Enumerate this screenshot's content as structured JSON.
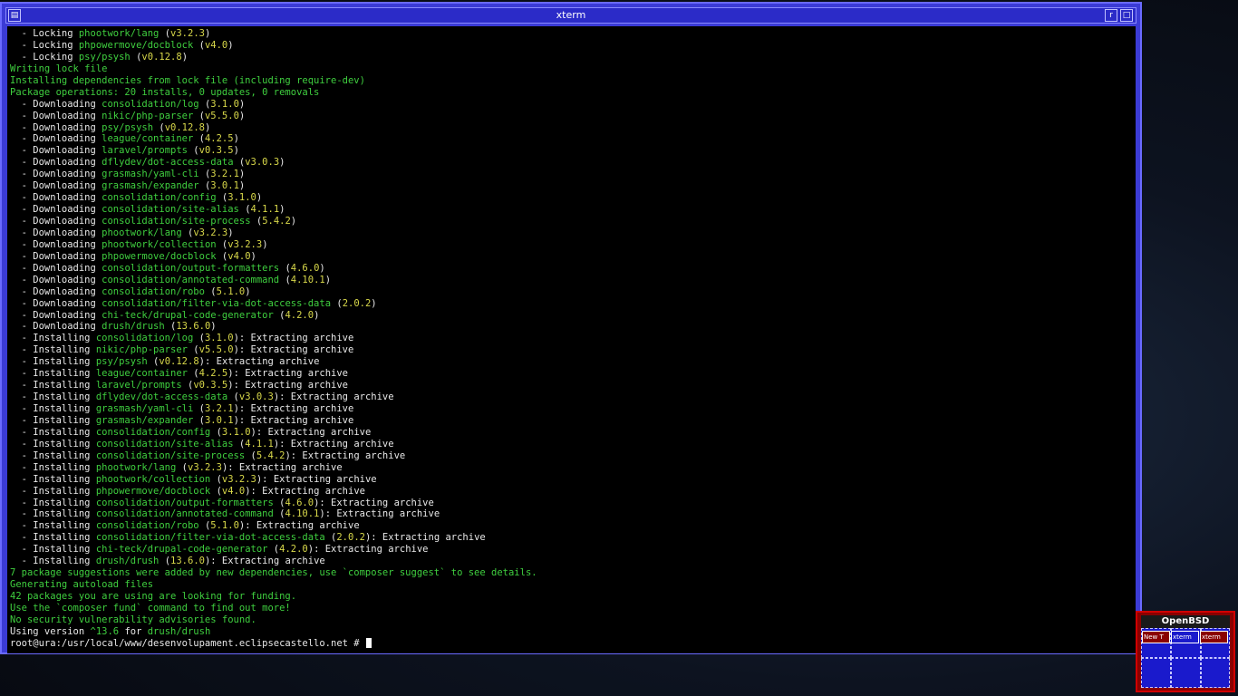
{
  "window": {
    "title": "xterm",
    "menu_icon": "window-menu-icon",
    "restore_label": "r",
    "maximize_label": "□"
  },
  "colors": {
    "terminal_bg": "#000000",
    "text": "#e8e8e8",
    "package": "#3fcf3f",
    "version": "#d8d84a",
    "frame": "#3b3bd6"
  },
  "terminal": {
    "lines": [
      [
        {
          "t": "  - Locking ",
          "c": "w"
        },
        {
          "t": "phootwork/lang",
          "c": "g"
        },
        {
          "t": " (",
          "c": "w"
        },
        {
          "t": "v3.2.3",
          "c": "y"
        },
        {
          "t": ")",
          "c": "w"
        }
      ],
      [
        {
          "t": "  - Locking ",
          "c": "w"
        },
        {
          "t": "phpowermove/docblock",
          "c": "g"
        },
        {
          "t": " (",
          "c": "w"
        },
        {
          "t": "v4.0",
          "c": "y"
        },
        {
          "t": ")",
          "c": "w"
        }
      ],
      [
        {
          "t": "  - Locking ",
          "c": "w"
        },
        {
          "t": "psy/psysh",
          "c": "g"
        },
        {
          "t": " (",
          "c": "w"
        },
        {
          "t": "v0.12.8",
          "c": "y"
        },
        {
          "t": ")",
          "c": "w"
        }
      ],
      [
        {
          "t": "Writing lock file",
          "c": "g"
        }
      ],
      [
        {
          "t": "Installing dependencies from lock file (including require-dev)",
          "c": "g"
        }
      ],
      [
        {
          "t": "Package operations: 20 installs, 0 updates, 0 removals",
          "c": "g"
        }
      ],
      [
        {
          "t": "  - Downloading ",
          "c": "w"
        },
        {
          "t": "consolidation/log",
          "c": "g"
        },
        {
          "t": " (",
          "c": "w"
        },
        {
          "t": "3.1.0",
          "c": "y"
        },
        {
          "t": ")",
          "c": "w"
        }
      ],
      [
        {
          "t": "  - Downloading ",
          "c": "w"
        },
        {
          "t": "nikic/php-parser",
          "c": "g"
        },
        {
          "t": " (",
          "c": "w"
        },
        {
          "t": "v5.5.0",
          "c": "y"
        },
        {
          "t": ")",
          "c": "w"
        }
      ],
      [
        {
          "t": "  - Downloading ",
          "c": "w"
        },
        {
          "t": "psy/psysh",
          "c": "g"
        },
        {
          "t": " (",
          "c": "w"
        },
        {
          "t": "v0.12.8",
          "c": "y"
        },
        {
          "t": ")",
          "c": "w"
        }
      ],
      [
        {
          "t": "  - Downloading ",
          "c": "w"
        },
        {
          "t": "league/container",
          "c": "g"
        },
        {
          "t": " (",
          "c": "w"
        },
        {
          "t": "4.2.5",
          "c": "y"
        },
        {
          "t": ")",
          "c": "w"
        }
      ],
      [
        {
          "t": "  - Downloading ",
          "c": "w"
        },
        {
          "t": "laravel/prompts",
          "c": "g"
        },
        {
          "t": " (",
          "c": "w"
        },
        {
          "t": "v0.3.5",
          "c": "y"
        },
        {
          "t": ")",
          "c": "w"
        }
      ],
      [
        {
          "t": "  - Downloading ",
          "c": "w"
        },
        {
          "t": "dflydev/dot-access-data",
          "c": "g"
        },
        {
          "t": " (",
          "c": "w"
        },
        {
          "t": "v3.0.3",
          "c": "y"
        },
        {
          "t": ")",
          "c": "w"
        }
      ],
      [
        {
          "t": "  - Downloading ",
          "c": "w"
        },
        {
          "t": "grasmash/yaml-cli",
          "c": "g"
        },
        {
          "t": " (",
          "c": "w"
        },
        {
          "t": "3.2.1",
          "c": "y"
        },
        {
          "t": ")",
          "c": "w"
        }
      ],
      [
        {
          "t": "  - Downloading ",
          "c": "w"
        },
        {
          "t": "grasmash/expander",
          "c": "g"
        },
        {
          "t": " (",
          "c": "w"
        },
        {
          "t": "3.0.1",
          "c": "y"
        },
        {
          "t": ")",
          "c": "w"
        }
      ],
      [
        {
          "t": "  - Downloading ",
          "c": "w"
        },
        {
          "t": "consolidation/config",
          "c": "g"
        },
        {
          "t": " (",
          "c": "w"
        },
        {
          "t": "3.1.0",
          "c": "y"
        },
        {
          "t": ")",
          "c": "w"
        }
      ],
      [
        {
          "t": "  - Downloading ",
          "c": "w"
        },
        {
          "t": "consolidation/site-alias",
          "c": "g"
        },
        {
          "t": " (",
          "c": "w"
        },
        {
          "t": "4.1.1",
          "c": "y"
        },
        {
          "t": ")",
          "c": "w"
        }
      ],
      [
        {
          "t": "  - Downloading ",
          "c": "w"
        },
        {
          "t": "consolidation/site-process",
          "c": "g"
        },
        {
          "t": " (",
          "c": "w"
        },
        {
          "t": "5.4.2",
          "c": "y"
        },
        {
          "t": ")",
          "c": "w"
        }
      ],
      [
        {
          "t": "  - Downloading ",
          "c": "w"
        },
        {
          "t": "phootwork/lang",
          "c": "g"
        },
        {
          "t": " (",
          "c": "w"
        },
        {
          "t": "v3.2.3",
          "c": "y"
        },
        {
          "t": ")",
          "c": "w"
        }
      ],
      [
        {
          "t": "  - Downloading ",
          "c": "w"
        },
        {
          "t": "phootwork/collection",
          "c": "g"
        },
        {
          "t": " (",
          "c": "w"
        },
        {
          "t": "v3.2.3",
          "c": "y"
        },
        {
          "t": ")",
          "c": "w"
        }
      ],
      [
        {
          "t": "  - Downloading ",
          "c": "w"
        },
        {
          "t": "phpowermove/docblock",
          "c": "g"
        },
        {
          "t": " (",
          "c": "w"
        },
        {
          "t": "v4.0",
          "c": "y"
        },
        {
          "t": ")",
          "c": "w"
        }
      ],
      [
        {
          "t": "  - Downloading ",
          "c": "w"
        },
        {
          "t": "consolidation/output-formatters",
          "c": "g"
        },
        {
          "t": " (",
          "c": "w"
        },
        {
          "t": "4.6.0",
          "c": "y"
        },
        {
          "t": ")",
          "c": "w"
        }
      ],
      [
        {
          "t": "  - Downloading ",
          "c": "w"
        },
        {
          "t": "consolidation/annotated-command",
          "c": "g"
        },
        {
          "t": " (",
          "c": "w"
        },
        {
          "t": "4.10.1",
          "c": "y"
        },
        {
          "t": ")",
          "c": "w"
        }
      ],
      [
        {
          "t": "  - Downloading ",
          "c": "w"
        },
        {
          "t": "consolidation/robo",
          "c": "g"
        },
        {
          "t": " (",
          "c": "w"
        },
        {
          "t": "5.1.0",
          "c": "y"
        },
        {
          "t": ")",
          "c": "w"
        }
      ],
      [
        {
          "t": "  - Downloading ",
          "c": "w"
        },
        {
          "t": "consolidation/filter-via-dot-access-data",
          "c": "g"
        },
        {
          "t": " (",
          "c": "w"
        },
        {
          "t": "2.0.2",
          "c": "y"
        },
        {
          "t": ")",
          "c": "w"
        }
      ],
      [
        {
          "t": "  - Downloading ",
          "c": "w"
        },
        {
          "t": "chi-teck/drupal-code-generator",
          "c": "g"
        },
        {
          "t": " (",
          "c": "w"
        },
        {
          "t": "4.2.0",
          "c": "y"
        },
        {
          "t": ")",
          "c": "w"
        }
      ],
      [
        {
          "t": "  - Downloading ",
          "c": "w"
        },
        {
          "t": "drush/drush",
          "c": "g"
        },
        {
          "t": " (",
          "c": "w"
        },
        {
          "t": "13.6.0",
          "c": "y"
        },
        {
          "t": ")",
          "c": "w"
        }
      ],
      [
        {
          "t": "  - Installing ",
          "c": "w"
        },
        {
          "t": "consolidation/log",
          "c": "g"
        },
        {
          "t": " (",
          "c": "w"
        },
        {
          "t": "3.1.0",
          "c": "y"
        },
        {
          "t": "): Extracting archive",
          "c": "w"
        }
      ],
      [
        {
          "t": "  - Installing ",
          "c": "w"
        },
        {
          "t": "nikic/php-parser",
          "c": "g"
        },
        {
          "t": " (",
          "c": "w"
        },
        {
          "t": "v5.5.0",
          "c": "y"
        },
        {
          "t": "): Extracting archive",
          "c": "w"
        }
      ],
      [
        {
          "t": "  - Installing ",
          "c": "w"
        },
        {
          "t": "psy/psysh",
          "c": "g"
        },
        {
          "t": " (",
          "c": "w"
        },
        {
          "t": "v0.12.8",
          "c": "y"
        },
        {
          "t": "): Extracting archive",
          "c": "w"
        }
      ],
      [
        {
          "t": "  - Installing ",
          "c": "w"
        },
        {
          "t": "league/container",
          "c": "g"
        },
        {
          "t": " (",
          "c": "w"
        },
        {
          "t": "4.2.5",
          "c": "y"
        },
        {
          "t": "): Extracting archive",
          "c": "w"
        }
      ],
      [
        {
          "t": "  - Installing ",
          "c": "w"
        },
        {
          "t": "laravel/prompts",
          "c": "g"
        },
        {
          "t": " (",
          "c": "w"
        },
        {
          "t": "v0.3.5",
          "c": "y"
        },
        {
          "t": "): Extracting archive",
          "c": "w"
        }
      ],
      [
        {
          "t": "  - Installing ",
          "c": "w"
        },
        {
          "t": "dflydev/dot-access-data",
          "c": "g"
        },
        {
          "t": " (",
          "c": "w"
        },
        {
          "t": "v3.0.3",
          "c": "y"
        },
        {
          "t": "): Extracting archive",
          "c": "w"
        }
      ],
      [
        {
          "t": "  - Installing ",
          "c": "w"
        },
        {
          "t": "grasmash/yaml-cli",
          "c": "g"
        },
        {
          "t": " (",
          "c": "w"
        },
        {
          "t": "3.2.1",
          "c": "y"
        },
        {
          "t": "): Extracting archive",
          "c": "w"
        }
      ],
      [
        {
          "t": "  - Installing ",
          "c": "w"
        },
        {
          "t": "grasmash/expander",
          "c": "g"
        },
        {
          "t": " (",
          "c": "w"
        },
        {
          "t": "3.0.1",
          "c": "y"
        },
        {
          "t": "): Extracting archive",
          "c": "w"
        }
      ],
      [
        {
          "t": "  - Installing ",
          "c": "w"
        },
        {
          "t": "consolidation/config",
          "c": "g"
        },
        {
          "t": " (",
          "c": "w"
        },
        {
          "t": "3.1.0",
          "c": "y"
        },
        {
          "t": "): Extracting archive",
          "c": "w"
        }
      ],
      [
        {
          "t": "  - Installing ",
          "c": "w"
        },
        {
          "t": "consolidation/site-alias",
          "c": "g"
        },
        {
          "t": " (",
          "c": "w"
        },
        {
          "t": "4.1.1",
          "c": "y"
        },
        {
          "t": "): Extracting archive",
          "c": "w"
        }
      ],
      [
        {
          "t": "  - Installing ",
          "c": "w"
        },
        {
          "t": "consolidation/site-process",
          "c": "g"
        },
        {
          "t": " (",
          "c": "w"
        },
        {
          "t": "5.4.2",
          "c": "y"
        },
        {
          "t": "): Extracting archive",
          "c": "w"
        }
      ],
      [
        {
          "t": "  - Installing ",
          "c": "w"
        },
        {
          "t": "phootwork/lang",
          "c": "g"
        },
        {
          "t": " (",
          "c": "w"
        },
        {
          "t": "v3.2.3",
          "c": "y"
        },
        {
          "t": "): Extracting archive",
          "c": "w"
        }
      ],
      [
        {
          "t": "  - Installing ",
          "c": "w"
        },
        {
          "t": "phootwork/collection",
          "c": "g"
        },
        {
          "t": " (",
          "c": "w"
        },
        {
          "t": "v3.2.3",
          "c": "y"
        },
        {
          "t": "): Extracting archive",
          "c": "w"
        }
      ],
      [
        {
          "t": "  - Installing ",
          "c": "w"
        },
        {
          "t": "phpowermove/docblock",
          "c": "g"
        },
        {
          "t": " (",
          "c": "w"
        },
        {
          "t": "v4.0",
          "c": "y"
        },
        {
          "t": "): Extracting archive",
          "c": "w"
        }
      ],
      [
        {
          "t": "  - Installing ",
          "c": "w"
        },
        {
          "t": "consolidation/output-formatters",
          "c": "g"
        },
        {
          "t": " (",
          "c": "w"
        },
        {
          "t": "4.6.0",
          "c": "y"
        },
        {
          "t": "): Extracting archive",
          "c": "w"
        }
      ],
      [
        {
          "t": "  - Installing ",
          "c": "w"
        },
        {
          "t": "consolidation/annotated-command",
          "c": "g"
        },
        {
          "t": " (",
          "c": "w"
        },
        {
          "t": "4.10.1",
          "c": "y"
        },
        {
          "t": "): Extracting archive",
          "c": "w"
        }
      ],
      [
        {
          "t": "  - Installing ",
          "c": "w"
        },
        {
          "t": "consolidation/robo",
          "c": "g"
        },
        {
          "t": " (",
          "c": "w"
        },
        {
          "t": "5.1.0",
          "c": "y"
        },
        {
          "t": "): Extracting archive",
          "c": "w"
        }
      ],
      [
        {
          "t": "  - Installing ",
          "c": "w"
        },
        {
          "t": "consolidation/filter-via-dot-access-data",
          "c": "g"
        },
        {
          "t": " (",
          "c": "w"
        },
        {
          "t": "2.0.2",
          "c": "y"
        },
        {
          "t": "): Extracting archive",
          "c": "w"
        }
      ],
      [
        {
          "t": "  - Installing ",
          "c": "w"
        },
        {
          "t": "chi-teck/drupal-code-generator",
          "c": "g"
        },
        {
          "t": " (",
          "c": "w"
        },
        {
          "t": "4.2.0",
          "c": "y"
        },
        {
          "t": "): Extracting archive",
          "c": "w"
        }
      ],
      [
        {
          "t": "  - Installing ",
          "c": "w"
        },
        {
          "t": "drush/drush",
          "c": "g"
        },
        {
          "t": " (",
          "c": "w"
        },
        {
          "t": "13.6.0",
          "c": "y"
        },
        {
          "t": "): Extracting archive",
          "c": "w"
        }
      ],
      [
        {
          "t": "7 package suggestions were added by new dependencies, use `composer suggest` to see details.",
          "c": "g"
        }
      ],
      [
        {
          "t": "Generating autoload files",
          "c": "g"
        }
      ],
      [
        {
          "t": "42 packages you are using are looking for funding.",
          "c": "g"
        }
      ],
      [
        {
          "t": "Use the `composer fund` command to find out more!",
          "c": "g"
        }
      ],
      [
        {
          "t": "No security vulnerability advisories found.",
          "c": "g"
        }
      ],
      [
        {
          "t": "Using version ",
          "c": "w"
        },
        {
          "t": "^13.6",
          "c": "g"
        },
        {
          "t": " for ",
          "c": "w"
        },
        {
          "t": "drush/drush",
          "c": "g"
        }
      ]
    ],
    "prompt": "root@ura:/usr/local/www/desenvolupament.eclipsecastello.net # "
  },
  "pager": {
    "title": "OpenBSD",
    "windows": [
      {
        "label": "New T",
        "bg": "#8a0000"
      },
      {
        "label": "xterm",
        "bg": "#1a1acc"
      },
      {
        "label": "xterm",
        "bg": "#8a0000"
      }
    ]
  }
}
